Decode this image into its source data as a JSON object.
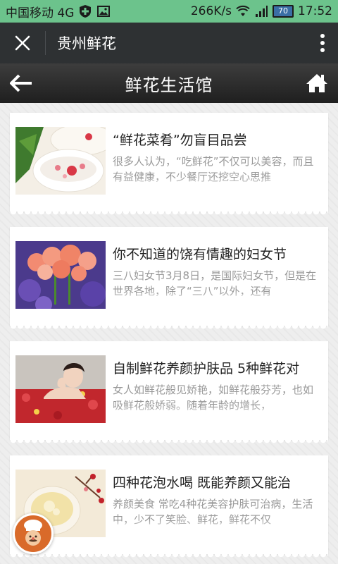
{
  "status_bar": {
    "carrier": "中国移动 4G",
    "speed": "266K/s",
    "battery": "70",
    "time": "17:52"
  },
  "wechat_bar": {
    "title": "贵州鲜花"
  },
  "header": {
    "title": "鲜花生活馆"
  },
  "articles": [
    {
      "title": "“鲜花菜肴”勿盲目品尝",
      "summary": "很多人认为，“吃鲜花”不仅可以美容，而且有益健康，不少餐厅还挖空心思推"
    },
    {
      "title": "你不知道的饶有情趣的妇女节",
      "summary": "三八妇女节3月8日，是国际妇女节，但是在世界各地，除了“三八”以外，还有"
    },
    {
      "title": "自制鲜花养颜护肤品 5种鲜花对",
      "summary": "女人如鲜花般见娇艳，如鲜花般芬芳，也如吸鲜花般娇弱。随着年龄的增长，"
    },
    {
      "title": "四种花泡水喝 既能养颜又能治",
      "summary": "养颜美食 常吃4种花美容护肤可治病，生活中，少不了笑脸、鲜花，鲜花不仅"
    }
  ],
  "colors": {
    "status_bar_bg": "#6cc38c",
    "wechat_bar_bg": "#2e3133",
    "header_bg": "#2b2b2b"
  }
}
